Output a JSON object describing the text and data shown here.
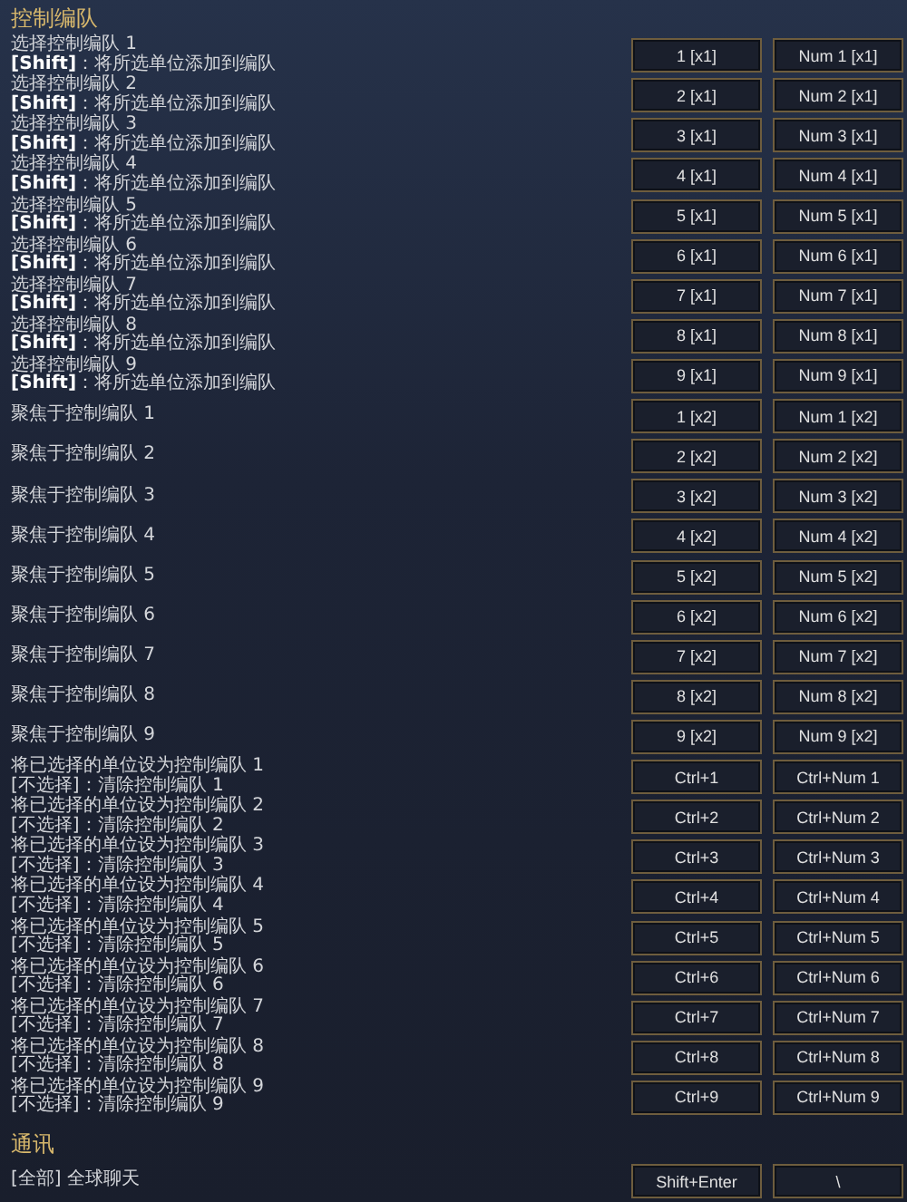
{
  "sections": [
    {
      "title": "控制编队",
      "rows": [
        {
          "lines": [
            "选择控制编队 1",
            "**[Shift]**：将所选单位添加到编队"
          ],
          "keys": [
            "1 [x1]",
            "Num 1 [x1]"
          ]
        },
        {
          "lines": [
            "选择控制编队 2",
            "**[Shift]**：将所选单位添加到编队"
          ],
          "keys": [
            "2 [x1]",
            "Num 2 [x1]"
          ]
        },
        {
          "lines": [
            "选择控制编队 3",
            "**[Shift]**：将所选单位添加到编队"
          ],
          "keys": [
            "3 [x1]",
            "Num 3 [x1]"
          ]
        },
        {
          "lines": [
            "选择控制编队 4",
            "**[Shift]**：将所选单位添加到编队"
          ],
          "keys": [
            "4 [x1]",
            "Num 4 [x1]"
          ]
        },
        {
          "lines": [
            "选择控制编队 5",
            "**[Shift]**：将所选单位添加到编队"
          ],
          "keys": [
            "5 [x1]",
            "Num 5 [x1]"
          ]
        },
        {
          "lines": [
            "选择控制编队 6",
            "**[Shift]**：将所选单位添加到编队"
          ],
          "keys": [
            "6 [x1]",
            "Num 6 [x1]"
          ]
        },
        {
          "lines": [
            "选择控制编队 7",
            "**[Shift]**：将所选单位添加到编队"
          ],
          "keys": [
            "7 [x1]",
            "Num 7 [x1]"
          ]
        },
        {
          "lines": [
            "选择控制编队 8",
            "**[Shift]**：将所选单位添加到编队"
          ],
          "keys": [
            "8 [x1]",
            "Num 8 [x1]"
          ]
        },
        {
          "lines": [
            "选择控制编队 9",
            "**[Shift]**：将所选单位添加到编队"
          ],
          "keys": [
            "9 [x1]",
            "Num 9 [x1]"
          ]
        },
        {
          "lines": [
            "聚焦于控制编队 1"
          ],
          "keys": [
            "1 [x2]",
            "Num 1 [x2]"
          ]
        },
        {
          "lines": [
            "聚焦于控制编队 2"
          ],
          "keys": [
            "2 [x2]",
            "Num 2 [x2]"
          ]
        },
        {
          "lines": [
            "聚焦于控制编队 3"
          ],
          "keys": [
            "3 [x2]",
            "Num 3 [x2]"
          ]
        },
        {
          "lines": [
            "聚焦于控制编队 4"
          ],
          "keys": [
            "4 [x2]",
            "Num 4 [x2]"
          ]
        },
        {
          "lines": [
            "聚焦于控制编队 5"
          ],
          "keys": [
            "5 [x2]",
            "Num 5 [x2]"
          ]
        },
        {
          "lines": [
            "聚焦于控制编队 6"
          ],
          "keys": [
            "6 [x2]",
            "Num 6 [x2]"
          ]
        },
        {
          "lines": [
            "聚焦于控制编队 7"
          ],
          "keys": [
            "7 [x2]",
            "Num 7 [x2]"
          ]
        },
        {
          "lines": [
            "聚焦于控制编队 8"
          ],
          "keys": [
            "8 [x2]",
            "Num 8 [x2]"
          ]
        },
        {
          "lines": [
            "聚焦于控制编队 9"
          ],
          "keys": [
            "9 [x2]",
            "Num 9 [x2]"
          ]
        },
        {
          "lines": [
            "将已选择的单位设为控制编队 1",
            "[不选择]：清除控制编队 1"
          ],
          "keys": [
            "Ctrl+1",
            "Ctrl+Num 1"
          ]
        },
        {
          "lines": [
            "将已选择的单位设为控制编队 2",
            "[不选择]：清除控制编队 2"
          ],
          "keys": [
            "Ctrl+2",
            "Ctrl+Num 2"
          ]
        },
        {
          "lines": [
            "将已选择的单位设为控制编队 3",
            "[不选择]：清除控制编队 3"
          ],
          "keys": [
            "Ctrl+3",
            "Ctrl+Num 3"
          ]
        },
        {
          "lines": [
            "将已选择的单位设为控制编队 4",
            "[不选择]：清除控制编队 4"
          ],
          "keys": [
            "Ctrl+4",
            "Ctrl+Num 4"
          ]
        },
        {
          "lines": [
            "将已选择的单位设为控制编队 5",
            "[不选择]：清除控制编队 5"
          ],
          "keys": [
            "Ctrl+5",
            "Ctrl+Num 5"
          ]
        },
        {
          "lines": [
            "将已选择的单位设为控制编队 6",
            "[不选择]：清除控制编队 6"
          ],
          "keys": [
            "Ctrl+6",
            "Ctrl+Num 6"
          ]
        },
        {
          "lines": [
            "将已选择的单位设为控制编队 7",
            "[不选择]：清除控制编队 7"
          ],
          "keys": [
            "Ctrl+7",
            "Ctrl+Num 7"
          ]
        },
        {
          "lines": [
            "将已选择的单位设为控制编队 8",
            "[不选择]：清除控制编队 8"
          ],
          "keys": [
            "Ctrl+8",
            "Ctrl+Num 8"
          ]
        },
        {
          "lines": [
            "将已选择的单位设为控制编队 9",
            "[不选择]：清除控制编队 9"
          ],
          "keys": [
            "Ctrl+9",
            "Ctrl+Num 9"
          ]
        }
      ]
    },
    {
      "title": "通讯",
      "rows": [
        {
          "lines": [
            "[全部] 全球聊天"
          ],
          "keys": [
            "Shift+Enter",
            "\\"
          ]
        }
      ]
    }
  ]
}
